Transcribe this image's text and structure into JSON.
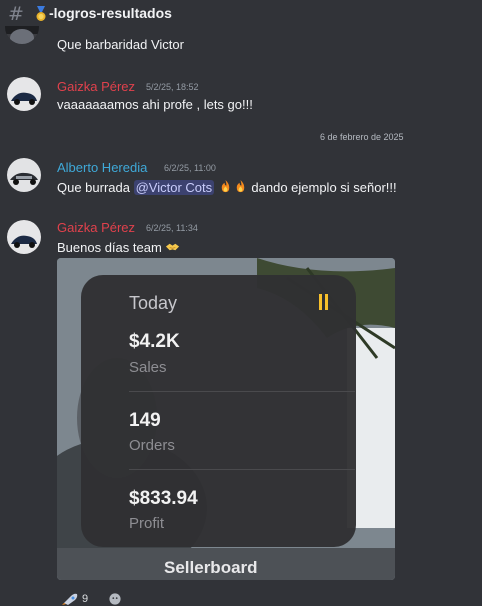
{
  "channel": {
    "name": "-logros-resultados",
    "hash_icon": "#",
    "medal_icon": "medal-icon"
  },
  "messages": [
    {
      "text": "Que barbaridad Victor"
    },
    {
      "author": "Gaizka Pérez",
      "time": "5/2/25, 18:52",
      "text": "vaaaaaaamos ahi profe , lets go!!!"
    },
    {
      "author": "Alberto Heredia",
      "time": "6/2/25, 11:00",
      "text_before": "Que burrada ",
      "mention": "@Victor Cots",
      "text_after": " dando ejemplo si señor!!!"
    },
    {
      "author": "Gaizka Pérez",
      "time": "6/2/25, 11:34",
      "text": "Buenos días team"
    }
  ],
  "date_divider": "6 de febrero de 2025",
  "widget": {
    "title": "Today",
    "sales_value": "$4.2K",
    "sales_label": "Sales",
    "orders_value": "149",
    "orders_label": "Orders",
    "profit_value": "$833.94",
    "profit_label": "Profit",
    "brand": "Sellerboard"
  },
  "reactions": {
    "rocket_count": "9"
  },
  "colors": {
    "background": "#313338",
    "author_red": "#e0414c",
    "author_blue": "#3fa9d8",
    "mention_bg": "#3c4270"
  }
}
